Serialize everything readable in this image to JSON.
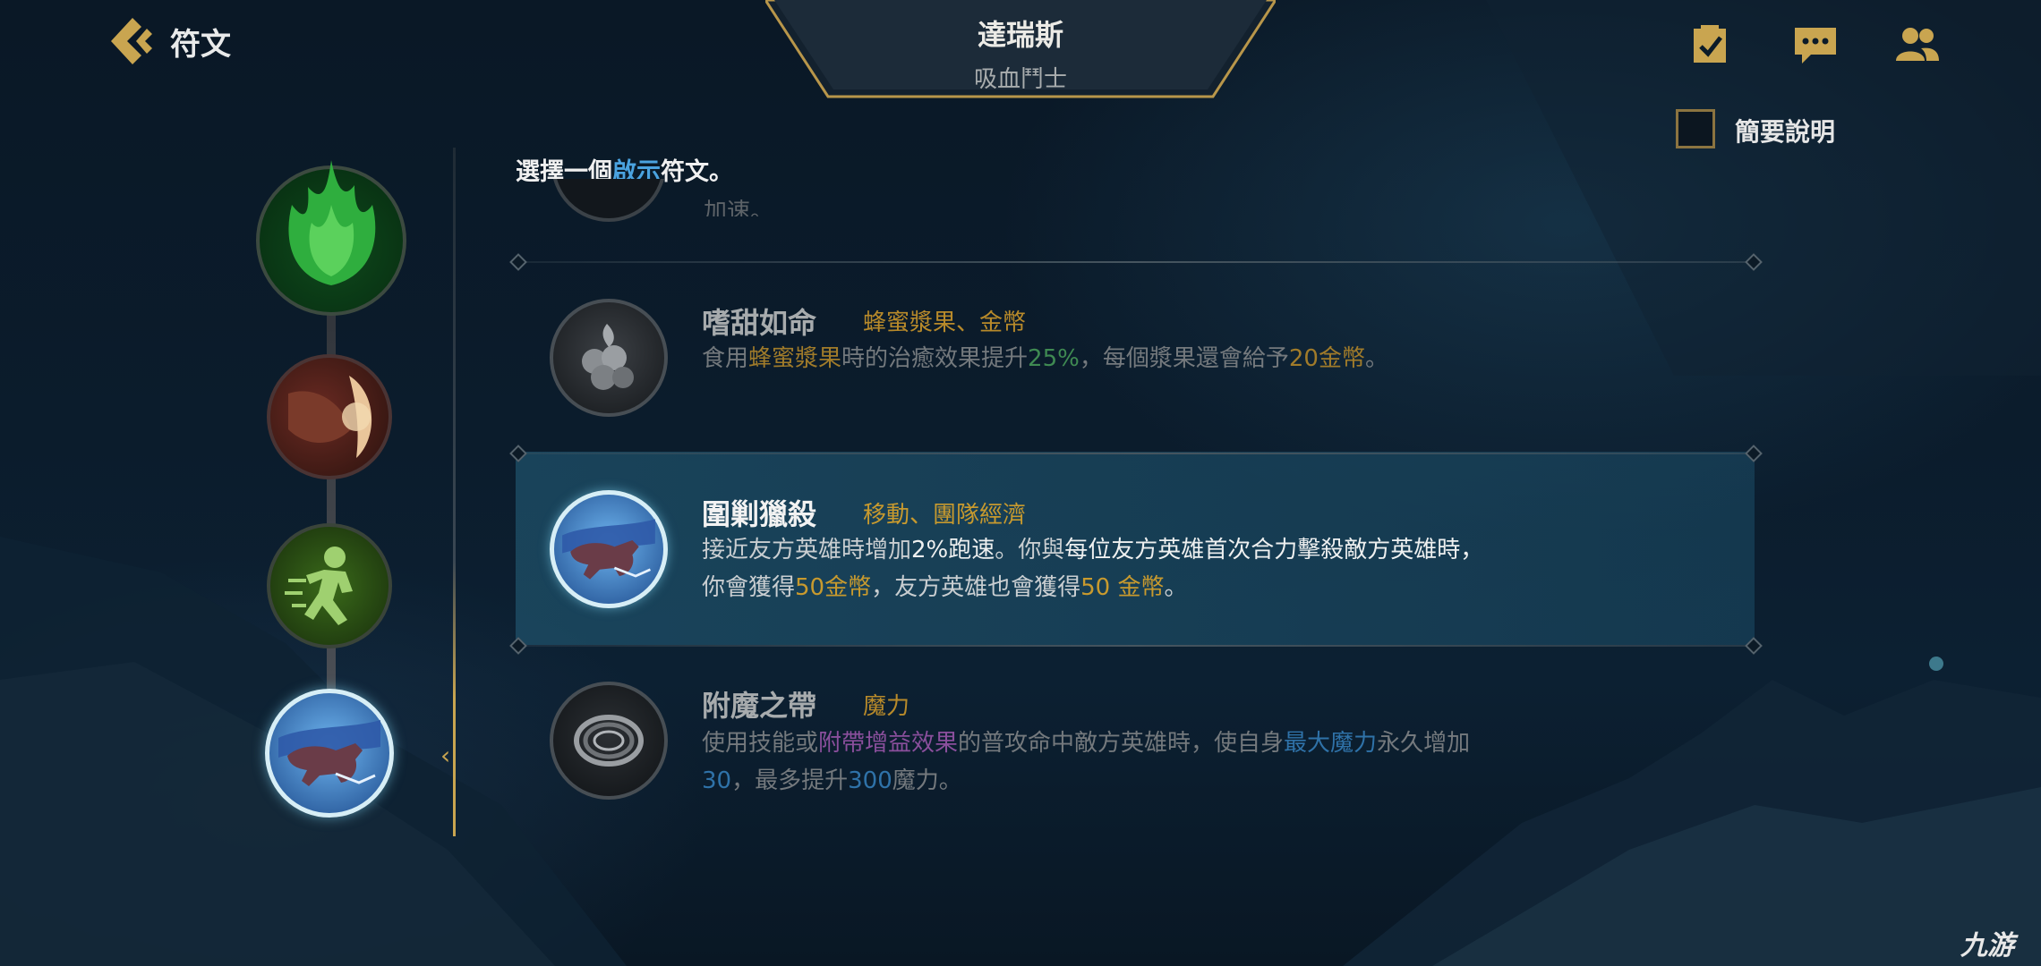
{
  "header": {
    "back_label": "符文",
    "champion_name": "達瑞斯",
    "champion_subtitle": "吸血鬥士",
    "summary_toggle_label": "簡要說明"
  },
  "prompt": {
    "prefix": "選擇一個",
    "highlight": "啟示",
    "suffix": "符文。"
  },
  "cut_row_text": "加速。",
  "runes": [
    {
      "name": "嗜甜如命",
      "tags": "蜂蜜漿果、金幣",
      "desc_1": "食用",
      "desc_2": "蜂蜜漿果",
      "desc_3": "時的治癒效果提升",
      "desc_4": "25%",
      "desc_5": "，每個漿果還會給予",
      "desc_6": "20金幣",
      "desc_7": "。"
    },
    {
      "name": "圍剿獵殺",
      "tags": "移動、團隊經濟",
      "line1_a": "接近友方英雄時增加",
      "line1_b": "2%跑速",
      "line1_c": "。你與",
      "line1_d": "每位友方英雄首次合力擊殺敵方英雄時，",
      "line2_a": "你會獲得",
      "line2_b": "50金幣",
      "line2_c": "，友方英雄也會獲得",
      "line2_d": "50 金幣",
      "line2_e": "。"
    },
    {
      "name": "附魔之帶",
      "tags": "魔力",
      "line1_a": "使用技能或",
      "line1_b": "附帶增益效果",
      "line1_c": "的普攻命中敵方英雄時，使自身",
      "line1_d": "最大魔力",
      "line1_e": "永久增加",
      "line2_a": "30",
      "line2_b": "，最多提升",
      "line2_c": "300",
      "line2_d": "魔力。"
    }
  ],
  "watermark": "九游",
  "colors": {
    "gold": "#c89a2e",
    "accent_blue": "#4aa3e0",
    "highlight_row": "#1e5069",
    "frame_gold": "#c9a550"
  },
  "icons": [
    "back-chevron-icon",
    "checklist-icon",
    "chat-icon",
    "friends-icon"
  ]
}
